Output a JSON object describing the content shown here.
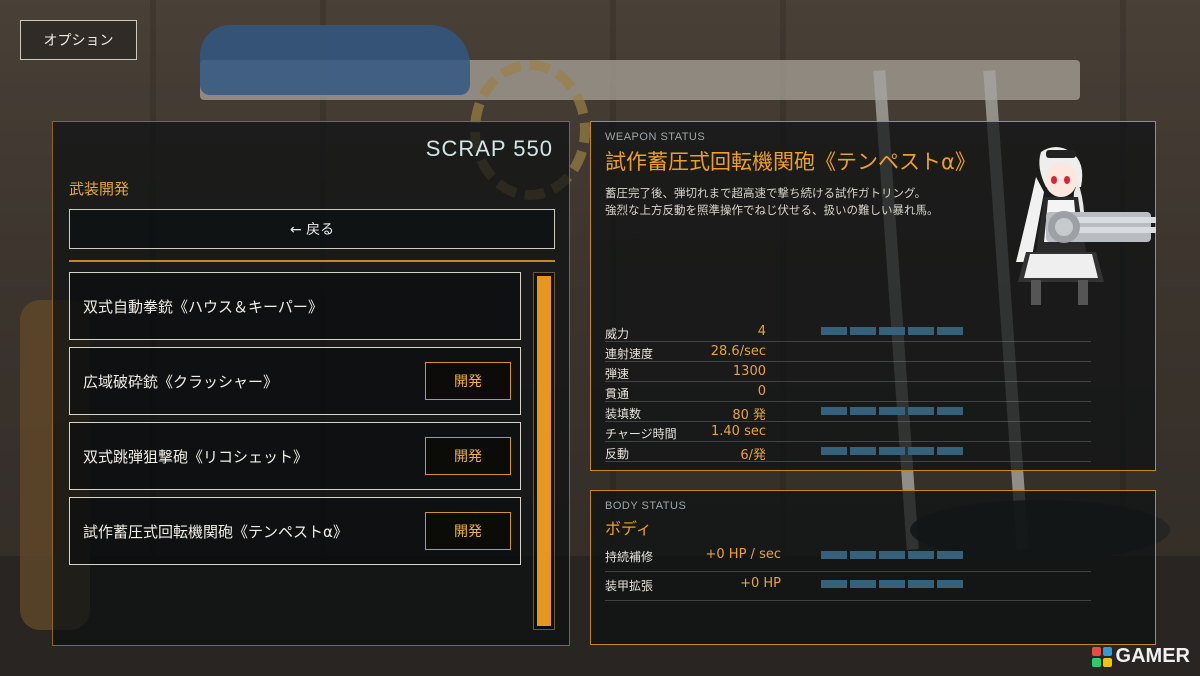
{
  "options_label": "オプション",
  "scrap": "SCRAP 550",
  "section_title": "武装開発",
  "back_label": "← 戻る",
  "develop_label": "開発",
  "weapons": [
    {
      "name": "双式自動拳銃《ハウス＆キーパー》",
      "developable": false
    },
    {
      "name": "広域破砕銃《クラッシャー》",
      "developable": true
    },
    {
      "name": "双式跳弾狙撃砲《リコシェット》",
      "developable": true
    },
    {
      "name": "試作蓄圧式回転機関砲《テンペストα》",
      "developable": true
    }
  ],
  "weapon_status": {
    "caption": "WEAPON STATUS",
    "title": "試作蓄圧式回転機関砲《テンペストα》",
    "desc_line1": "蓄圧完了後、弾切れまで超高速で撃ち続ける試作ガトリング。",
    "desc_line2": "強烈な上方反動を照準操作でねじ伏せる、扱いの難しい暴れ馬。",
    "stats": [
      {
        "label": "威力",
        "value": "4",
        "bar": 5
      },
      {
        "label": "連射速度",
        "value": "28.6/sec",
        "bar": 0
      },
      {
        "label": "弾速",
        "value": "1300",
        "bar": 0
      },
      {
        "label": "貫通",
        "value": "0",
        "bar": 0
      },
      {
        "label": "装填数",
        "value": "80 発",
        "bar": 5
      },
      {
        "label": "チャージ時間",
        "value": "1.40 sec",
        "bar": 0
      },
      {
        "label": "反動",
        "value": "6/発",
        "bar": 5
      }
    ]
  },
  "body_status": {
    "caption": "BODY STATUS",
    "title": "ボディ",
    "stats": [
      {
        "label": "持続補修",
        "value": "+0 HP / sec",
        "bar": 5
      },
      {
        "label": "装甲拡張",
        "value": "+0 HP",
        "bar": 5
      }
    ]
  },
  "brand": "GAMER",
  "colors": {
    "accent": "#e7971e",
    "title": "#ef9f25",
    "bar": "#35627a",
    "panel_border": "#c28a1c"
  }
}
